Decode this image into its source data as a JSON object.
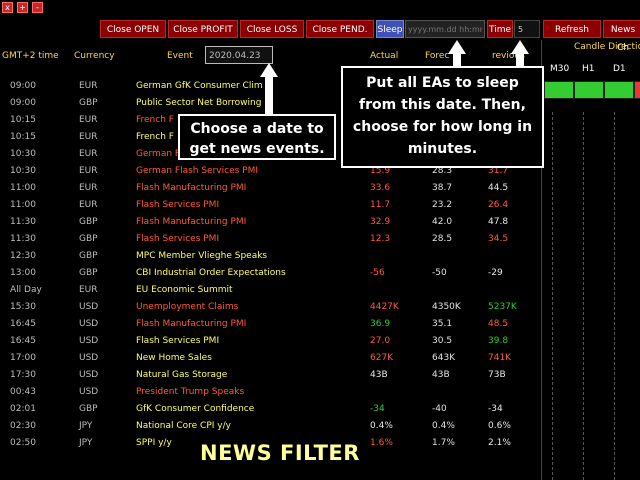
{
  "window_controls": [
    "x",
    "+",
    "-"
  ],
  "toolbar": {
    "close_open": "Close OPEN",
    "close_profit": "Close PROFIT",
    "close_loss": "Close LOSS",
    "close_pend": "Close PEND.",
    "sleep": "Sleep",
    "date_placeholder": "yyyy.mm.dd hh:mm",
    "time": "Time",
    "time_value": "5",
    "refresh": "Refresh",
    "news_partial": "News Ch"
  },
  "headers": {
    "time": "GMT+2 time",
    "currency": "Currency",
    "event": "Event",
    "date_input": "2020.04.23",
    "actual": "Actual",
    "forecast": "Forec",
    "previous": "revious"
  },
  "candle": {
    "title": "Candle Direction",
    "timeframes": [
      "M30",
      "H1",
      "D1"
    ]
  },
  "colors": {
    "red": "#ff5a3c",
    "yellow": "#ffff66",
    "green": "#33cc33",
    "button_bg": "#8b0000",
    "sleep_bg": "#3f51b5"
  },
  "rows": [
    {
      "time": "09:00",
      "currency": "EUR",
      "event": "German GfK Consumer Clim",
      "actual": "",
      "forecast": "",
      "previous": "",
      "event_color": "yellow",
      "actual_color": "",
      "previous_color": ""
    },
    {
      "time": "09:00",
      "currency": "GBP",
      "event": "Public Sector Net Borrowing",
      "actual": "",
      "forecast": "",
      "previous": "",
      "event_color": "yellow",
      "actual_color": "",
      "previous_color": ""
    },
    {
      "time": "10:15",
      "currency": "EUR",
      "event": "French F",
      "actual": "",
      "forecast": "",
      "previous": "",
      "event_color": "red",
      "actual_color": "",
      "previous_color": ""
    },
    {
      "time": "10:15",
      "currency": "EUR",
      "event": "French F",
      "actual": "",
      "forecast": "",
      "previous": "",
      "event_color": "yellow",
      "actual_color": "",
      "previous_color": ""
    },
    {
      "time": "10:30",
      "currency": "EUR",
      "event": "German F",
      "actual": "",
      "forecast": "",
      "previous": "",
      "event_color": "red",
      "actual_color": "",
      "previous_color": ""
    },
    {
      "time": "10:30",
      "currency": "EUR",
      "event": "German Flash Services PMI",
      "actual": "15.9",
      "forecast": "28.3",
      "previous": "31.7",
      "event_color": "red",
      "actual_color": "red",
      "previous_color": "red"
    },
    {
      "time": "11:00",
      "currency": "EUR",
      "event": "Flash Manufacturing PMI",
      "actual": "33.6",
      "forecast": "38.7",
      "previous": "44.5",
      "event_color": "red",
      "actual_color": "red",
      "previous_color": "white"
    },
    {
      "time": "11:00",
      "currency": "EUR",
      "event": "Flash Services PMI",
      "actual": "11.7",
      "forecast": "23.2",
      "previous": "26.4",
      "event_color": "red",
      "actual_color": "red",
      "previous_color": "red"
    },
    {
      "time": "11:30",
      "currency": "GBP",
      "event": "Flash Manufacturing PMI",
      "actual": "32.9",
      "forecast": "42.0",
      "previous": "47.8",
      "event_color": "red",
      "actual_color": "red",
      "previous_color": "white"
    },
    {
      "time": "11:30",
      "currency": "GBP",
      "event": "Flash Services PMI",
      "actual": "12.3",
      "forecast": "28.5",
      "previous": "34.5",
      "event_color": "red",
      "actual_color": "red",
      "previous_color": "red"
    },
    {
      "time": "12:30",
      "currency": "GBP",
      "event": "MPC Member Vlieghe Speaks",
      "actual": "",
      "forecast": "",
      "previous": "",
      "event_color": "yellow",
      "actual_color": "",
      "previous_color": ""
    },
    {
      "time": "13:00",
      "currency": "GBP",
      "event": "CBI Industrial Order Expectations",
      "actual": "-56",
      "forecast": "-50",
      "previous": "-29",
      "event_color": "yellow",
      "actual_color": "red",
      "previous_color": "white"
    },
    {
      "time": "All Day",
      "currency": "EUR",
      "event": "EU Economic Summit",
      "actual": "",
      "forecast": "",
      "previous": "",
      "event_color": "yellow",
      "actual_color": "",
      "previous_color": ""
    },
    {
      "time": "15:30",
      "currency": "USD",
      "event": "Unemployment Claims",
      "actual": "4427K",
      "forecast": "4350K",
      "previous": "5237K",
      "event_color": "red",
      "actual_color": "red",
      "previous_color": "green"
    },
    {
      "time": "16:45",
      "currency": "USD",
      "event": "Flash Manufacturing PMI",
      "actual": "36.9",
      "forecast": "35.1",
      "previous": "48.5",
      "event_color": "red",
      "actual_color": "green",
      "previous_color": "red"
    },
    {
      "time": "16:45",
      "currency": "USD",
      "event": "Flash Services PMI",
      "actual": "27.0",
      "forecast": "30.5",
      "previous": "39.8",
      "event_color": "yellow",
      "actual_color": "red",
      "previous_color": "green"
    },
    {
      "time": "17:00",
      "currency": "USD",
      "event": "New Home Sales",
      "actual": "627K",
      "forecast": "643K",
      "previous": "741K",
      "event_color": "yellow",
      "actual_color": "red",
      "previous_color": "red"
    },
    {
      "time": "17:30",
      "currency": "USD",
      "event": "Natural Gas Storage",
      "actual": "43B",
      "forecast": "43B",
      "previous": "73B",
      "event_color": "yellow",
      "actual_color": "white",
      "previous_color": "white"
    },
    {
      "time": "00:43",
      "currency": "USD",
      "event": "President Trump Speaks",
      "actual": "",
      "forecast": "",
      "previous": "",
      "event_color": "red",
      "actual_color": "",
      "previous_color": ""
    },
    {
      "time": "02:01",
      "currency": "GBP",
      "event": "GfK Consumer Confidence",
      "actual": "-34",
      "forecast": "-40",
      "previous": "-34",
      "event_color": "yellow",
      "actual_color": "green",
      "previous_color": "white"
    },
    {
      "time": "02:30",
      "currency": "JPY",
      "event": "National Core CPI y/y",
      "actual": "0.4%",
      "forecast": "0.4%",
      "previous": "0.6%",
      "event_color": "yellow",
      "actual_color": "white",
      "previous_color": "white"
    },
    {
      "time": "02:50",
      "currency": "JPY",
      "event": "SPPI y/y",
      "actual": "1.6%",
      "forecast": "1.7%",
      "previous": "2.1%",
      "event_color": "yellow",
      "actual_color": "red",
      "previous_color": "white"
    }
  ],
  "callouts": {
    "date_hint": "Choose a date to get news events.",
    "sleep_hint": "Put all EAs to sleep from this date. Then, choose for how long in minutes."
  },
  "footer_title": "NEWS FILTER"
}
